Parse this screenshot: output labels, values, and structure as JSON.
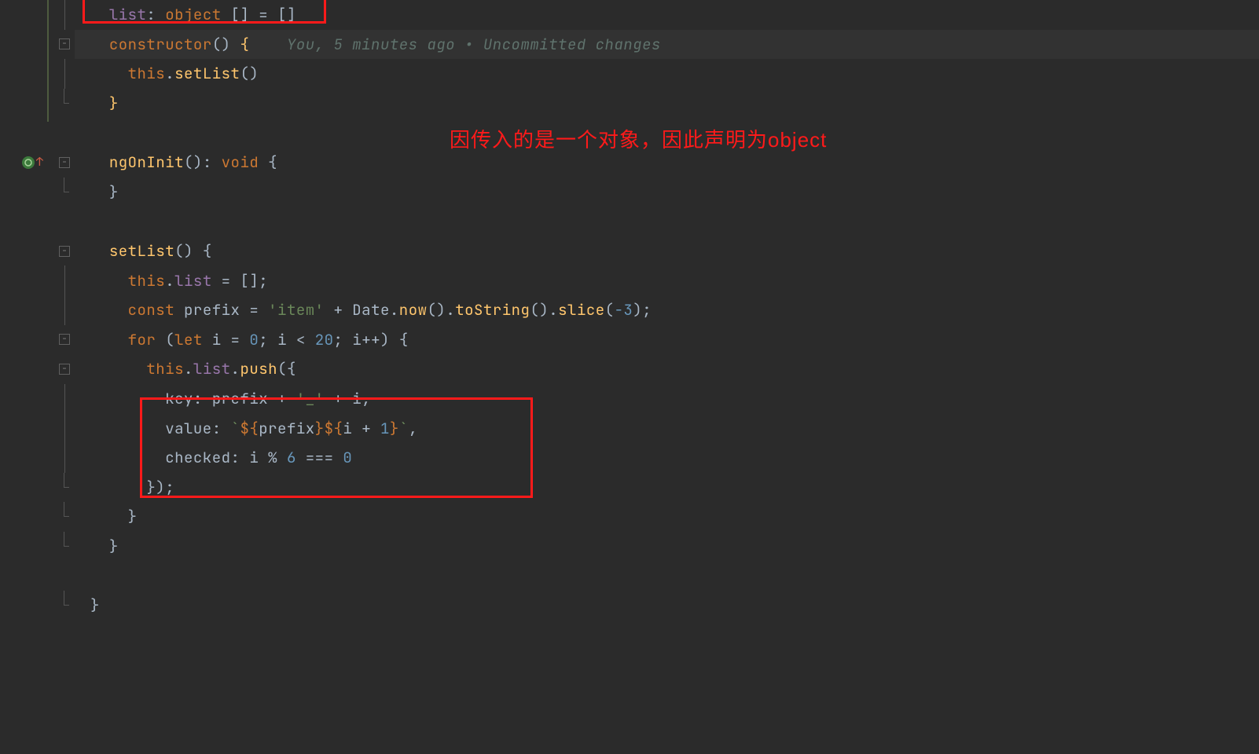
{
  "inline_comment": "You, 5 minutes ago • Uncommitted changes",
  "annotation_text": "因传入的是一个对象，因此声明为object",
  "code": {
    "l1": {
      "prop": "list",
      "type": "object",
      "arr": "[]",
      "eq": "=",
      "val": "[]"
    },
    "l2": {
      "ctor": "constructor",
      "parens": "()",
      "brace": "{"
    },
    "l3": {
      "this": "this",
      "dot": ".",
      "method": "setList",
      "parens": "()"
    },
    "l4": {
      "brace": "}"
    },
    "l6": {
      "name": "ngOnInit",
      "parens": "()",
      "colon": ":",
      "ret": "void",
      "brace": "{"
    },
    "l7": {
      "brace": "}"
    },
    "l9": {
      "name": "setList",
      "parens": "()",
      "brace": "{"
    },
    "l10": {
      "this": "this",
      "prop": "list",
      "eq": "=",
      "val": "[]",
      "semi": ";"
    },
    "l11": {
      "kw": "const",
      "name": "prefix",
      "eq": "=",
      "str": "'item'",
      "plus": "+",
      "obj": "Date",
      "m1": "now",
      "p1": "()",
      "m2": "toString",
      "p2": "()",
      "m3": "slice",
      "arg": "-3",
      "semi": ";"
    },
    "l12": {
      "for": "for",
      "let": "let",
      "var": "i",
      "eq": "=",
      "n0": "0",
      "lt": "<",
      "n20": "20",
      "inc": "i++",
      "brace": "{"
    },
    "l13": {
      "this": "this",
      "prop": "list",
      "method": "push",
      "brace": "({"
    },
    "l14": {
      "key": "key",
      "colon": ":",
      "v1": "prefix",
      "plus": "+",
      "str": "'_'",
      "plus2": "+",
      "v2": "i",
      "comma": ","
    },
    "l15": {
      "key": "value",
      "colon": ":",
      "bt1": "`",
      "tpl1": "${",
      "v1": "prefix",
      "tpl1e": "}",
      "tpl2": "${",
      "v2": "i",
      "plus": "+",
      "n1": "1",
      "tpl2e": "}",
      "bt2": "`",
      "comma": ","
    },
    "l16": {
      "key": "checked",
      "colon": ":",
      "v": "i",
      "mod": "%",
      "n6": "6",
      "eq3": "===",
      "n0": "0"
    },
    "l17": {
      "close": "});"
    },
    "l18": {
      "brace": "}"
    },
    "l19": {
      "brace": "}"
    },
    "l21": {
      "brace": "}"
    }
  }
}
